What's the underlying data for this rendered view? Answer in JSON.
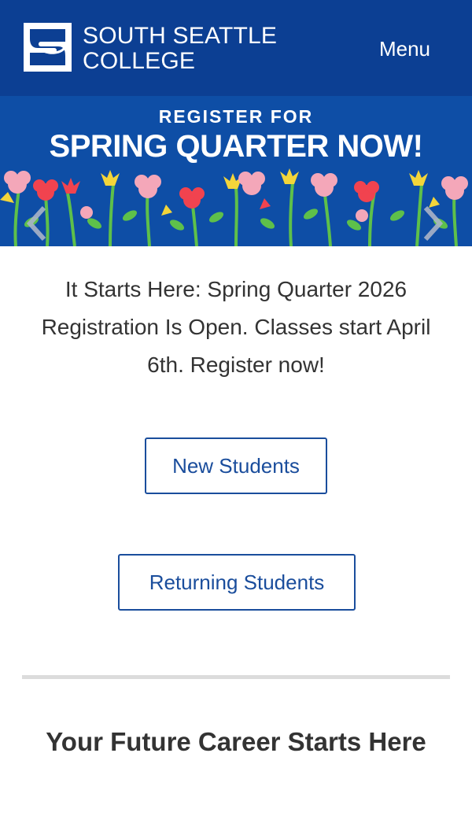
{
  "header": {
    "logo_line1": "SOUTH SEATTLE",
    "logo_line2": "COLLEGE",
    "menu_label": "Menu",
    "background": "#0c3f93"
  },
  "banner": {
    "kicker": "REGISTER FOR",
    "headline": "SPRING QUARTER NOW!",
    "background": "#0e4ea6",
    "prev_icon": "chevron-left-icon",
    "next_icon": "chevron-right-icon"
  },
  "main": {
    "intro": "It Starts Here: Spring Quarter 2026 Registration Is Open. Classes start April 6th. Register now!",
    "new_students_label": "New Students",
    "returning_students_label": "Returning Students",
    "link_color": "#1a4d9c"
  },
  "career": {
    "heading": "Your Future Career Starts Here"
  }
}
